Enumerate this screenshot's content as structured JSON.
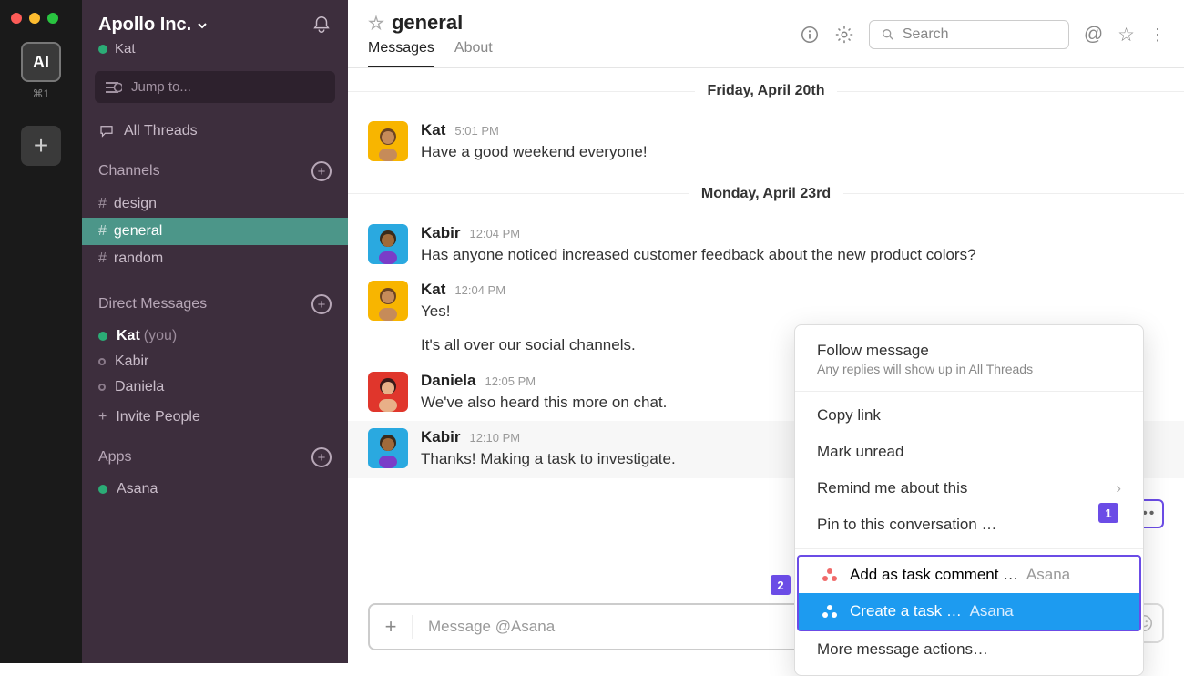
{
  "rail": {
    "workspace_initials": "AI",
    "shortcut": "⌘1"
  },
  "sidebar": {
    "workspace_name": "Apollo Inc.",
    "current_user": "Kat",
    "jump_placeholder": "Jump to...",
    "all_threads": "All Threads",
    "channels_header": "Channels",
    "channels": [
      {
        "name": "design",
        "active": false
      },
      {
        "name": "general",
        "active": true
      },
      {
        "name": "random",
        "active": false
      }
    ],
    "dm_header": "Direct Messages",
    "dms": [
      {
        "name": "Kat",
        "you_label": "(you)",
        "online": true,
        "bold": true
      },
      {
        "name": "Kabir",
        "online": false,
        "bold": false
      },
      {
        "name": "Daniela",
        "online": false,
        "bold": false
      }
    ],
    "invite_label": "Invite People",
    "apps_header": "Apps",
    "apps": [
      {
        "name": "Asana",
        "online": true
      }
    ]
  },
  "channel": {
    "name": "general",
    "tabs": {
      "messages": "Messages",
      "about": "About"
    },
    "search_placeholder": "Search"
  },
  "dividers": {
    "d1": "Friday, April 20th",
    "d2": "Monday, April 23rd"
  },
  "messages": [
    {
      "author": "Kat",
      "ts": "5:01 PM",
      "text": "Have a good weekend everyone!"
    },
    {
      "author": "Kabir",
      "ts": "12:04 PM",
      "text": "Has anyone noticed increased customer feedback about the new product colors?"
    },
    {
      "author": "Kat",
      "ts": "12:04 PM",
      "text": "Yes!",
      "text2": "It's all over our social channels."
    },
    {
      "author": "Daniela",
      "ts": "12:05 PM",
      "text": "We've also heard this more on chat."
    },
    {
      "author": "Kabir",
      "ts": "12:10 PM",
      "text": "Thanks! Making a task to investigate."
    }
  ],
  "menu": {
    "follow_title": "Follow message",
    "follow_sub": "Any replies will show up in All Threads",
    "copy_link": "Copy link",
    "mark_unread": "Mark unread",
    "remind": "Remind me about this",
    "pin": "Pin to this conversation …",
    "add_task_comment": "Add as task comment …",
    "create_task": "Create a task …",
    "asana_app": "Asana",
    "more_actions": "More message actions…"
  },
  "composer": {
    "placeholder": "Message @Asana"
  },
  "callouts": {
    "one": "1",
    "two": "2"
  }
}
